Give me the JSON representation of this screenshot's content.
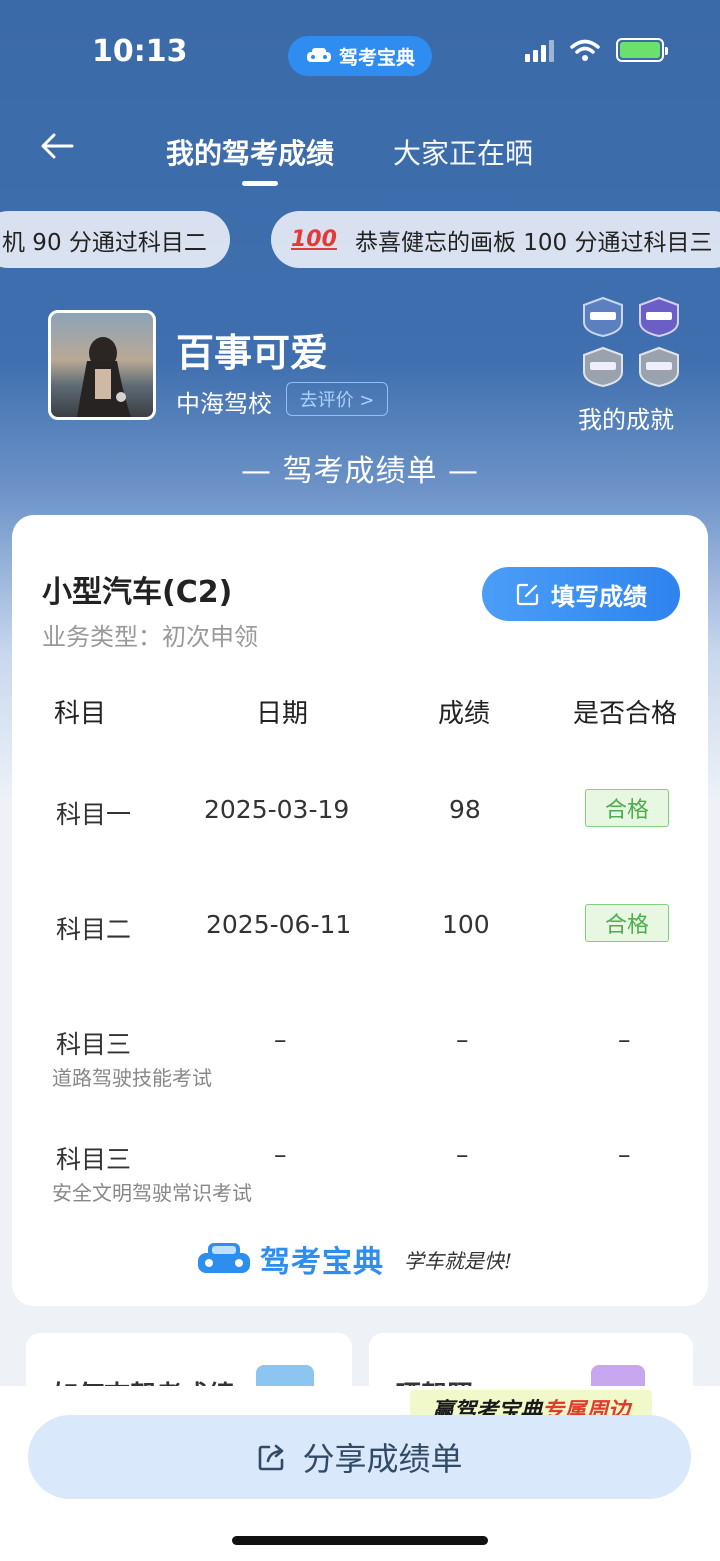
{
  "status_bar": {
    "time": "10:13",
    "app_pill": "驾考宝典"
  },
  "nav": {
    "tab_active": "我的驾考成绩",
    "tab_other": "大家正在晒"
  },
  "ticker": {
    "item1": "机 90 分通过科目二",
    "item2_emoji": "100",
    "item2": "恭喜健忘的画板 100 分通过科目三"
  },
  "profile": {
    "name": "百事可爱",
    "school": "中海驾校",
    "rate_label": "去评价 >",
    "achievements_label": "我的成就"
  },
  "section_title": "— 驾考成绩单 —",
  "card": {
    "license_type": "小型汽车(C2)",
    "business_type": "业务类型：初次申领",
    "fill_button": "填写成绩",
    "headers": [
      "科目",
      "日期",
      "成绩",
      "是否合格"
    ],
    "rows": [
      {
        "subject": "科目一",
        "sub": "",
        "date": "2025-03-19",
        "score": "98",
        "pass": "合格"
      },
      {
        "subject": "科目二",
        "sub": "",
        "date": "2025-06-11",
        "score": "100",
        "pass": "合格"
      },
      {
        "subject": "科目三",
        "sub": "道路驾驶技能考试",
        "date": "–",
        "score": "–",
        "pass": "–"
      },
      {
        "subject": "科目三",
        "sub": "安全文明驾驶常识考试",
        "date": "–",
        "score": "–",
        "pass": "–"
      }
    ],
    "logo_text": "驾考宝典",
    "slogan": "学车就是快!"
  },
  "mini_cards": {
    "left_title": "如何查驾考成绩",
    "right_title": "晒驾照"
  },
  "promo": {
    "text_a": "赢驾考宝典",
    "text_b": "专属周边"
  },
  "share_button": "分享成绩单",
  "colors": {
    "header_blue": "#3b6aa8",
    "accent_blue": "#2e83ee",
    "pass_green": "#4cae4c"
  }
}
